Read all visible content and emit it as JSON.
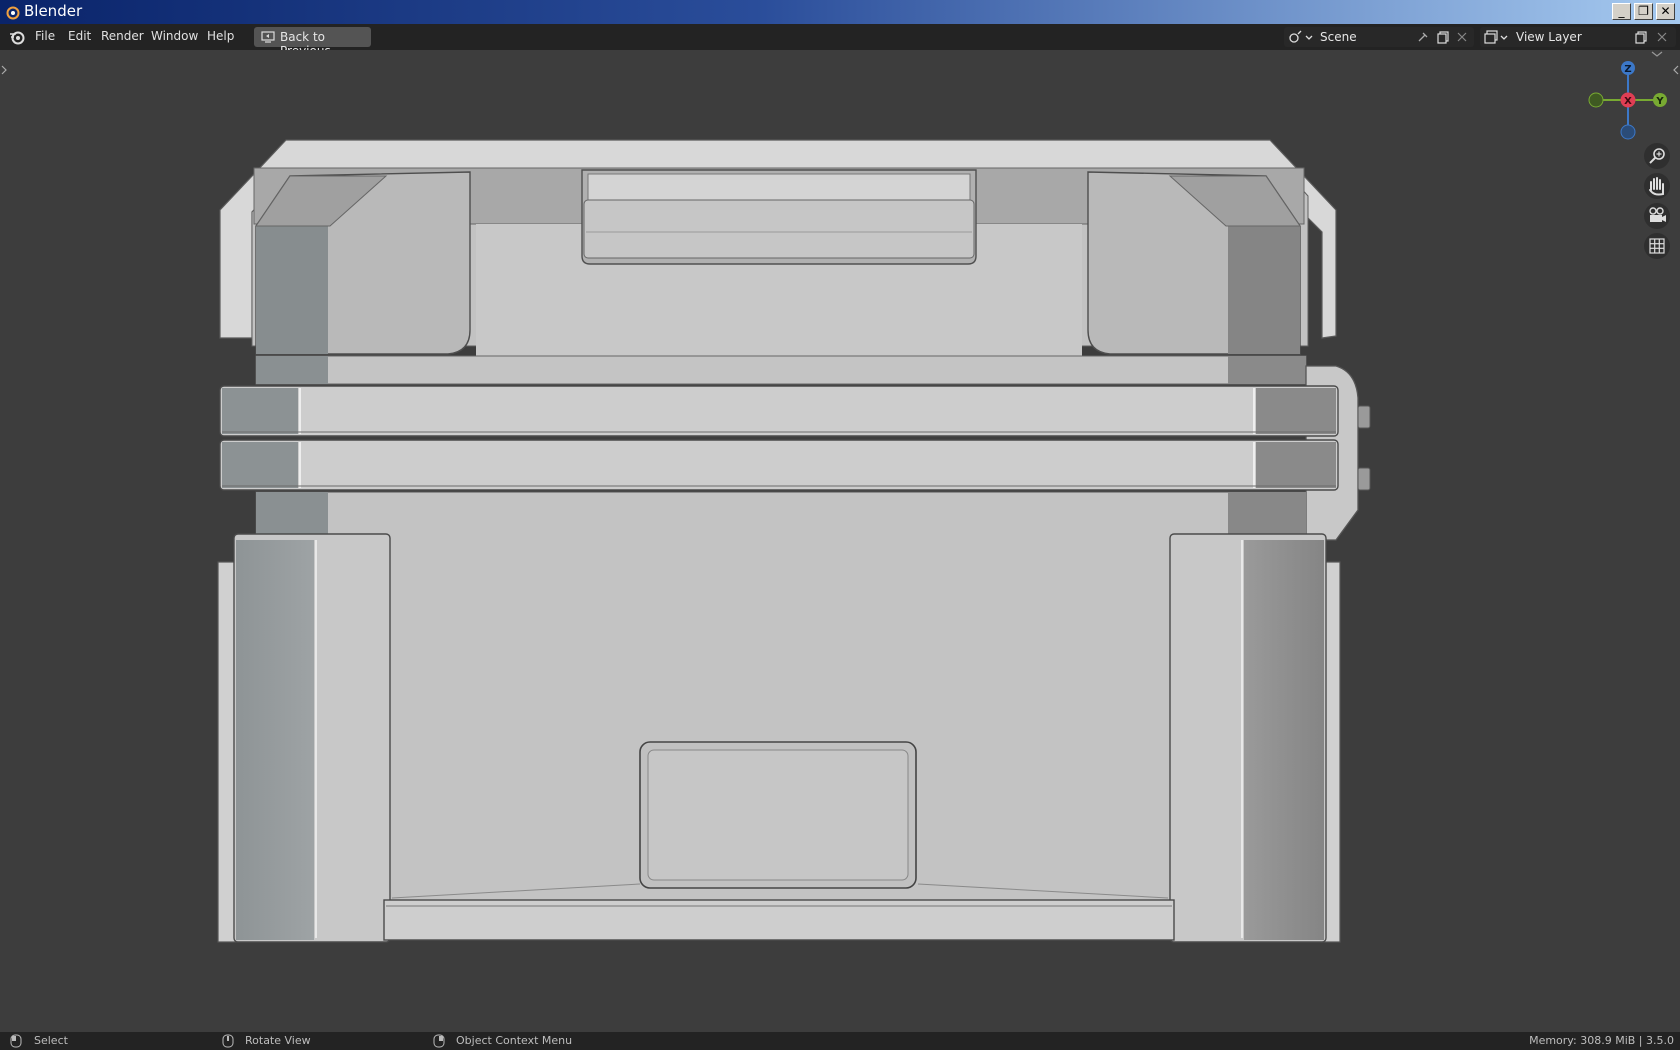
{
  "window": {
    "title": "Blender"
  },
  "menu": {
    "items": [
      "File",
      "Edit",
      "Render",
      "Window",
      "Help"
    ],
    "back_label": "Back to Previous"
  },
  "scene": {
    "name": "Scene"
  },
  "view_layer": {
    "name": "View Layer"
  },
  "gizmo": {
    "x": "X",
    "y": "Y",
    "z": "Z"
  },
  "status": {
    "select": "Select",
    "rotate": "Rotate View",
    "context": "Object Context Menu",
    "memory": "Memory: 308.9 MiB | 3.5.0"
  }
}
